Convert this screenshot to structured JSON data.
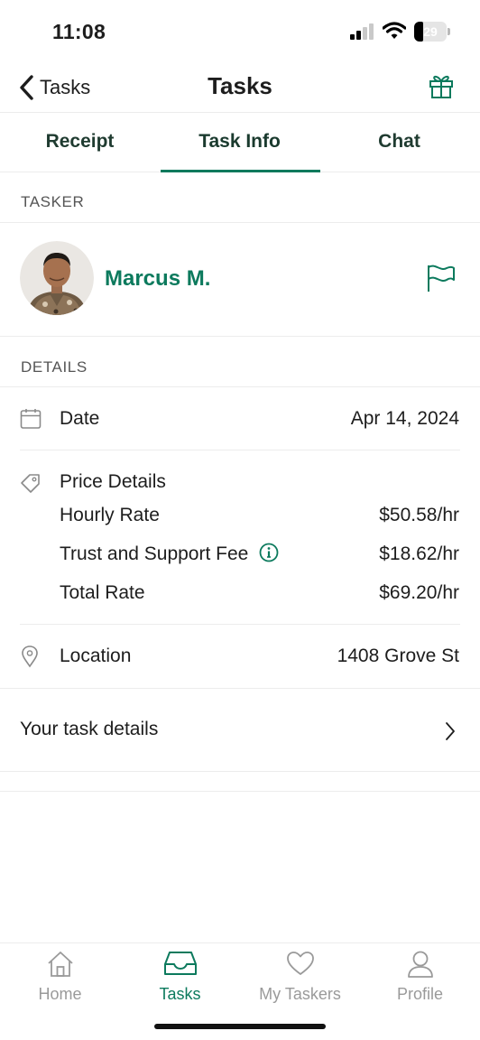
{
  "status_bar": {
    "time": "11:08",
    "battery": "29",
    "battery_level": 0.29
  },
  "nav": {
    "back_label": "Tasks",
    "title": "Tasks"
  },
  "tabs": [
    {
      "label": "Receipt",
      "active": false
    },
    {
      "label": "Task Info",
      "active": true
    },
    {
      "label": "Chat",
      "active": false
    }
  ],
  "tasker_section": {
    "header": "TASKER",
    "name": "Marcus M."
  },
  "details_section": {
    "header": "DETAILS",
    "date": {
      "label": "Date",
      "value": "Apr 14, 2024"
    },
    "price": {
      "label": "Price Details",
      "hourly_rate": {
        "label": "Hourly Rate",
        "value": "$50.58/hr"
      },
      "fee": {
        "label": "Trust and Support Fee",
        "value": "$18.62/hr"
      },
      "total": {
        "label": "Total Rate",
        "value": "$69.20/hr"
      }
    },
    "location": {
      "label": "Location",
      "value": "1408 Grove St"
    }
  },
  "task_details": {
    "label": "Your task details"
  },
  "tab_bar": [
    {
      "label": "Home",
      "icon": "house-icon",
      "active": false
    },
    {
      "label": "Tasks",
      "icon": "inbox-tray-icon",
      "active": true
    },
    {
      "label": "My Taskers",
      "icon": "heart-icon",
      "active": false
    },
    {
      "label": "Profile",
      "icon": "person-icon",
      "active": false
    }
  ],
  "colors": {
    "accent": "#0c7a5d",
    "text": "#1d1d1d",
    "muted": "#9a9a9a",
    "divider": "#ececec"
  }
}
